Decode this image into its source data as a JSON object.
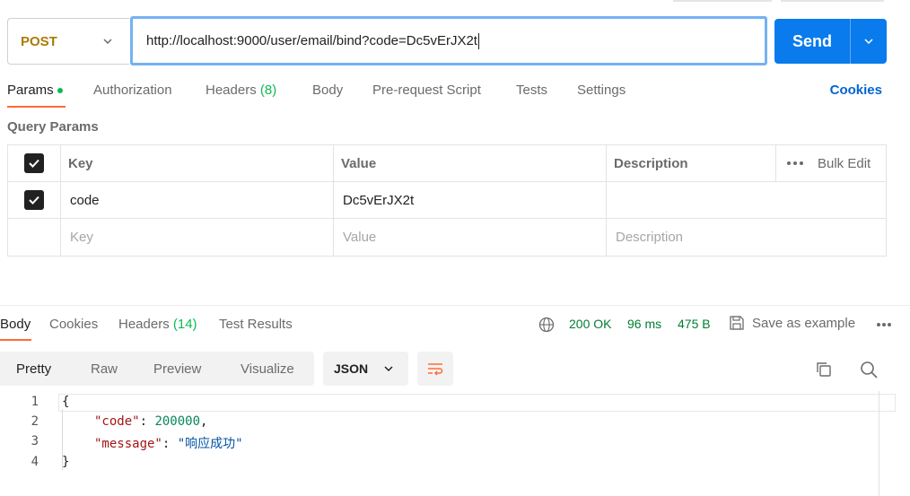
{
  "request": {
    "method": "POST",
    "url": "http://localhost:9000/user/email/bind?code=Dc5vErJX2t",
    "send_label": "Send"
  },
  "request_tabs": {
    "params": "Params",
    "authorization": "Authorization",
    "headers": "Headers",
    "headers_count": "(8)",
    "body": "Body",
    "prerequest": "Pre-request Script",
    "tests": "Tests",
    "settings": "Settings",
    "cookies": "Cookies"
  },
  "query_params": {
    "title": "Query Params",
    "headers": {
      "key": "Key",
      "value": "Value",
      "description": "Description",
      "bulk_edit": "Bulk Edit"
    },
    "rows": [
      {
        "key": "code",
        "value": "Dc5vErJX2t",
        "description": "",
        "checked": true
      }
    ],
    "placeholder": {
      "key": "Key",
      "value": "Value",
      "description": "Description"
    }
  },
  "response_tabs": {
    "body": "Body",
    "cookies": "Cookies",
    "headers": "Headers",
    "headers_count": "(14)",
    "test_results": "Test Results"
  },
  "response_status": {
    "status": "200 OK",
    "time": "96 ms",
    "size": "475 B",
    "save_example": "Save as example"
  },
  "view_modes": {
    "pretty": "Pretty",
    "raw": "Raw",
    "preview": "Preview",
    "visualize": "Visualize",
    "format": "JSON"
  },
  "response_body": {
    "line_numbers": [
      "1",
      "2",
      "3",
      "4"
    ],
    "open_brace": "{",
    "close_brace": "}",
    "code_key": "\"code\"",
    "code_value": "200000",
    "message_key": "\"message\"",
    "message_value": "\"响应成功\""
  },
  "colors": {
    "accent": "#ff6c37",
    "send": "#097bed",
    "method": "#ad7a03",
    "status_ok": "#007f31",
    "link": "#0265d2"
  },
  "icons": [
    "chevron-down-icon",
    "check-icon",
    "more-icon",
    "globe-icon",
    "save-icon",
    "wrap-icon",
    "copy-icon",
    "search-icon"
  ]
}
